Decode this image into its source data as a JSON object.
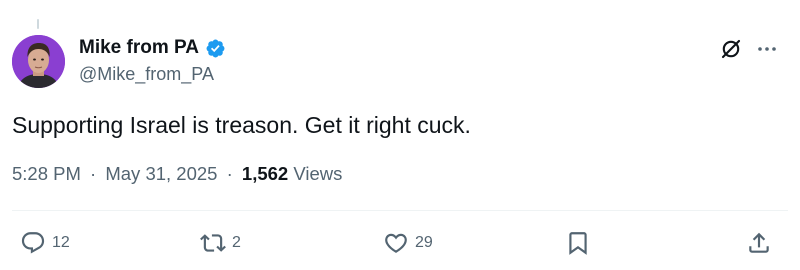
{
  "author": {
    "display_name": "Mike from PA",
    "handle": "@Mike_from_PA",
    "verified": true,
    "verified_color": "#1d9bf0"
  },
  "tweet": {
    "text": "Supporting Israel is treason. Get it right cuck.",
    "time": "5:28 PM",
    "date": "May 31, 2025",
    "separator": "·",
    "views_count": "1,562",
    "views_label": "Views"
  },
  "actions": {
    "replies": "12",
    "retweets": "2",
    "likes": "29"
  },
  "icons": {
    "header": [
      "grok-icon",
      "more-icon"
    ],
    "actions": [
      "reply-icon",
      "retweet-icon",
      "like-icon",
      "bookmark-icon",
      "share-icon"
    ]
  },
  "colors": {
    "text": "#0f1419",
    "secondary": "#536471",
    "divider": "#eff3f4",
    "avatar_bg": "#8a3fd1"
  }
}
